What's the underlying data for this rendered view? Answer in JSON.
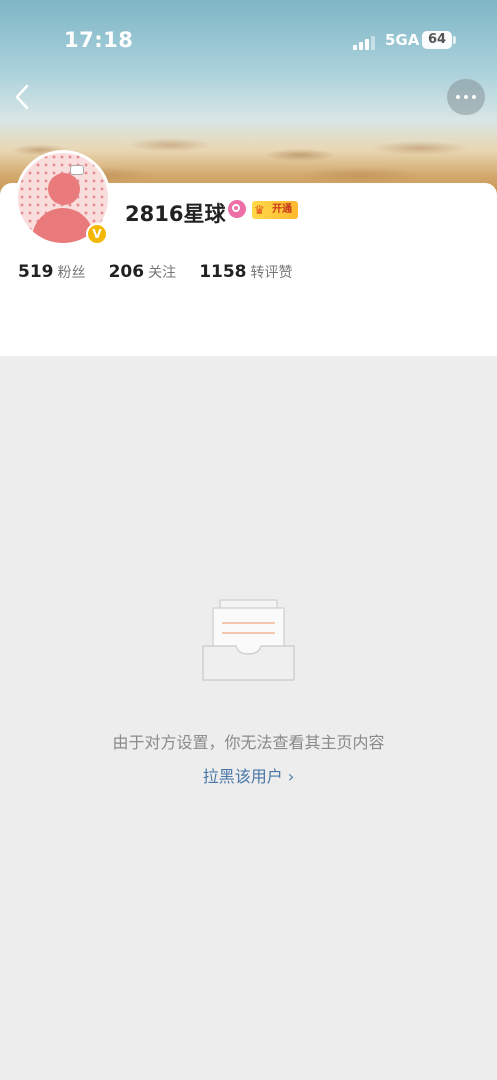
{
  "status_bar": {
    "time": "17:18",
    "network": "5GA",
    "battery": "64"
  },
  "header": {
    "back_icon": "chevron-left-icon",
    "more_icon": "more-dots-icon"
  },
  "profile": {
    "username": "2816星球",
    "verified_badge": "V",
    "vip_badge_label": "开通",
    "stats": [
      {
        "value": "519",
        "label": "粉丝"
      },
      {
        "value": "206",
        "label": "关注"
      },
      {
        "value": "1158",
        "label": "转评赞"
      }
    ]
  },
  "empty_state": {
    "icon": "empty-box-icon",
    "message": "由于对方设置，你无法查看其主页内容",
    "block_link": "拉黑该用户 ›"
  },
  "colors": {
    "background": "#ededed",
    "link": "#4a78a8",
    "verified": "#f5b800",
    "vip": "#ffc83a"
  }
}
